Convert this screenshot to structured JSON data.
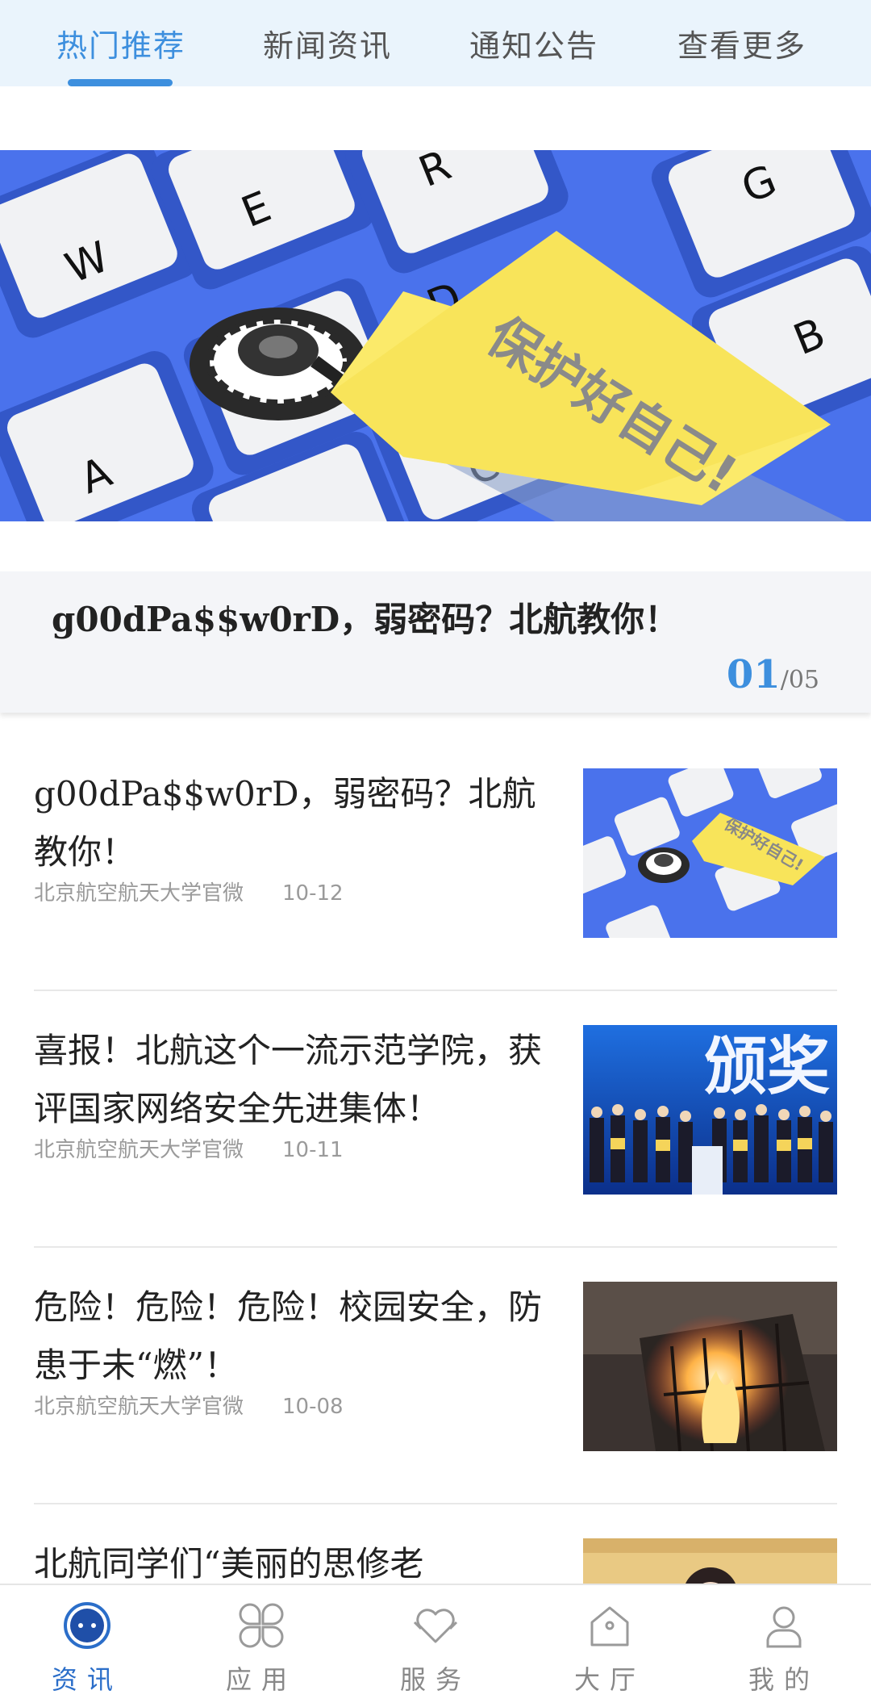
{
  "tabs": [
    {
      "label": "热门推荐",
      "active": true
    },
    {
      "label": "新闻资讯",
      "active": false
    },
    {
      "label": "通知公告",
      "active": false
    },
    {
      "label": "查看更多",
      "active": false
    }
  ],
  "banner": {
    "sign_text": "保护好自己!",
    "keys": [
      "W",
      "E",
      "R",
      "G",
      "B",
      "A",
      "C",
      "D"
    ]
  },
  "carousel": {
    "title": "g00dPa$$w0rD，弱密码？北航教你！",
    "current": "01",
    "total": "/05"
  },
  "articles": [
    {
      "title": "g00dPa$$w0rD，弱密码？北航教你！",
      "source": "北京航空航天大学官微",
      "date": "10-12",
      "thumb": "keyboard-trap"
    },
    {
      "title": "喜报！北航这个一流示范学院，获评国家网络安全先进集体！",
      "source": "北京航空航天大学官微",
      "date": "10-11",
      "thumb": "award-stage",
      "thumb_text": "颁奖"
    },
    {
      "title": "危险！危险！危险！校园安全，防患于未“燃”！",
      "source": "北京航空航天大学官微",
      "date": "10-08",
      "thumb": "building-fire"
    },
    {
      "title": "北航同学们“美丽的思修老",
      "thumb": "portrait"
    }
  ],
  "bottom_nav": [
    {
      "label": "资讯",
      "icon": "news-icon",
      "active": true
    },
    {
      "label": "应用",
      "icon": "apps-icon",
      "active": false
    },
    {
      "label": "服务",
      "icon": "service-heart-icon",
      "active": false
    },
    {
      "label": "大厅",
      "icon": "hall-house-icon",
      "active": false
    },
    {
      "label": "我的",
      "icon": "profile-icon",
      "active": false
    }
  ],
  "colors": {
    "accent": "#3d8fde",
    "tab_bar_bg": "#eaf4fc",
    "nav_active": "#2b6ec9",
    "meta_text": "#9a9a9a"
  }
}
